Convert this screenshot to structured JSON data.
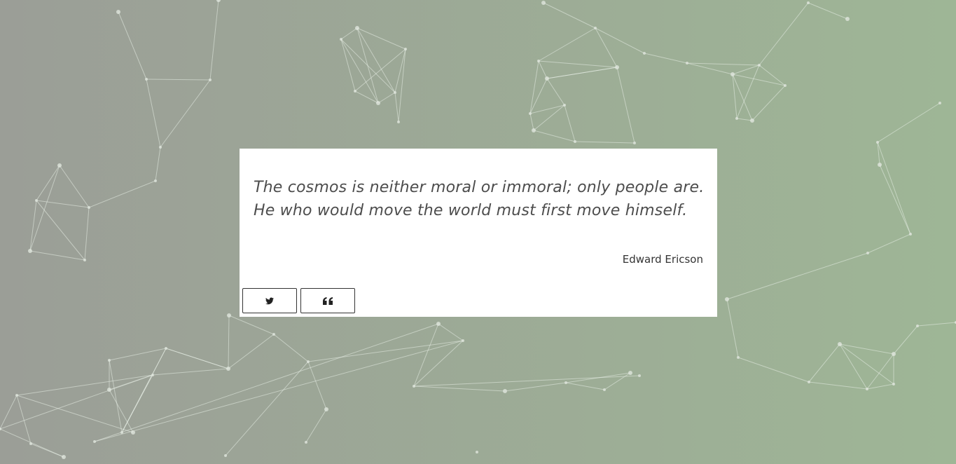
{
  "quote": {
    "text": "The cosmos is neither moral or immoral; only people are. He who would move the world must first move himself.",
    "author": "Edward Ericson"
  },
  "buttons": {
    "tweet_icon": "twitter-bird-icon",
    "new_quote_icon": "quote-marks-icon"
  },
  "colors": {
    "background_start": "#9b9e97",
    "background_end": "#9eb696",
    "card": "#ffffff",
    "quote_text": "#4d4d4d",
    "button_border": "#333333",
    "network_line": "#e6ece3"
  }
}
